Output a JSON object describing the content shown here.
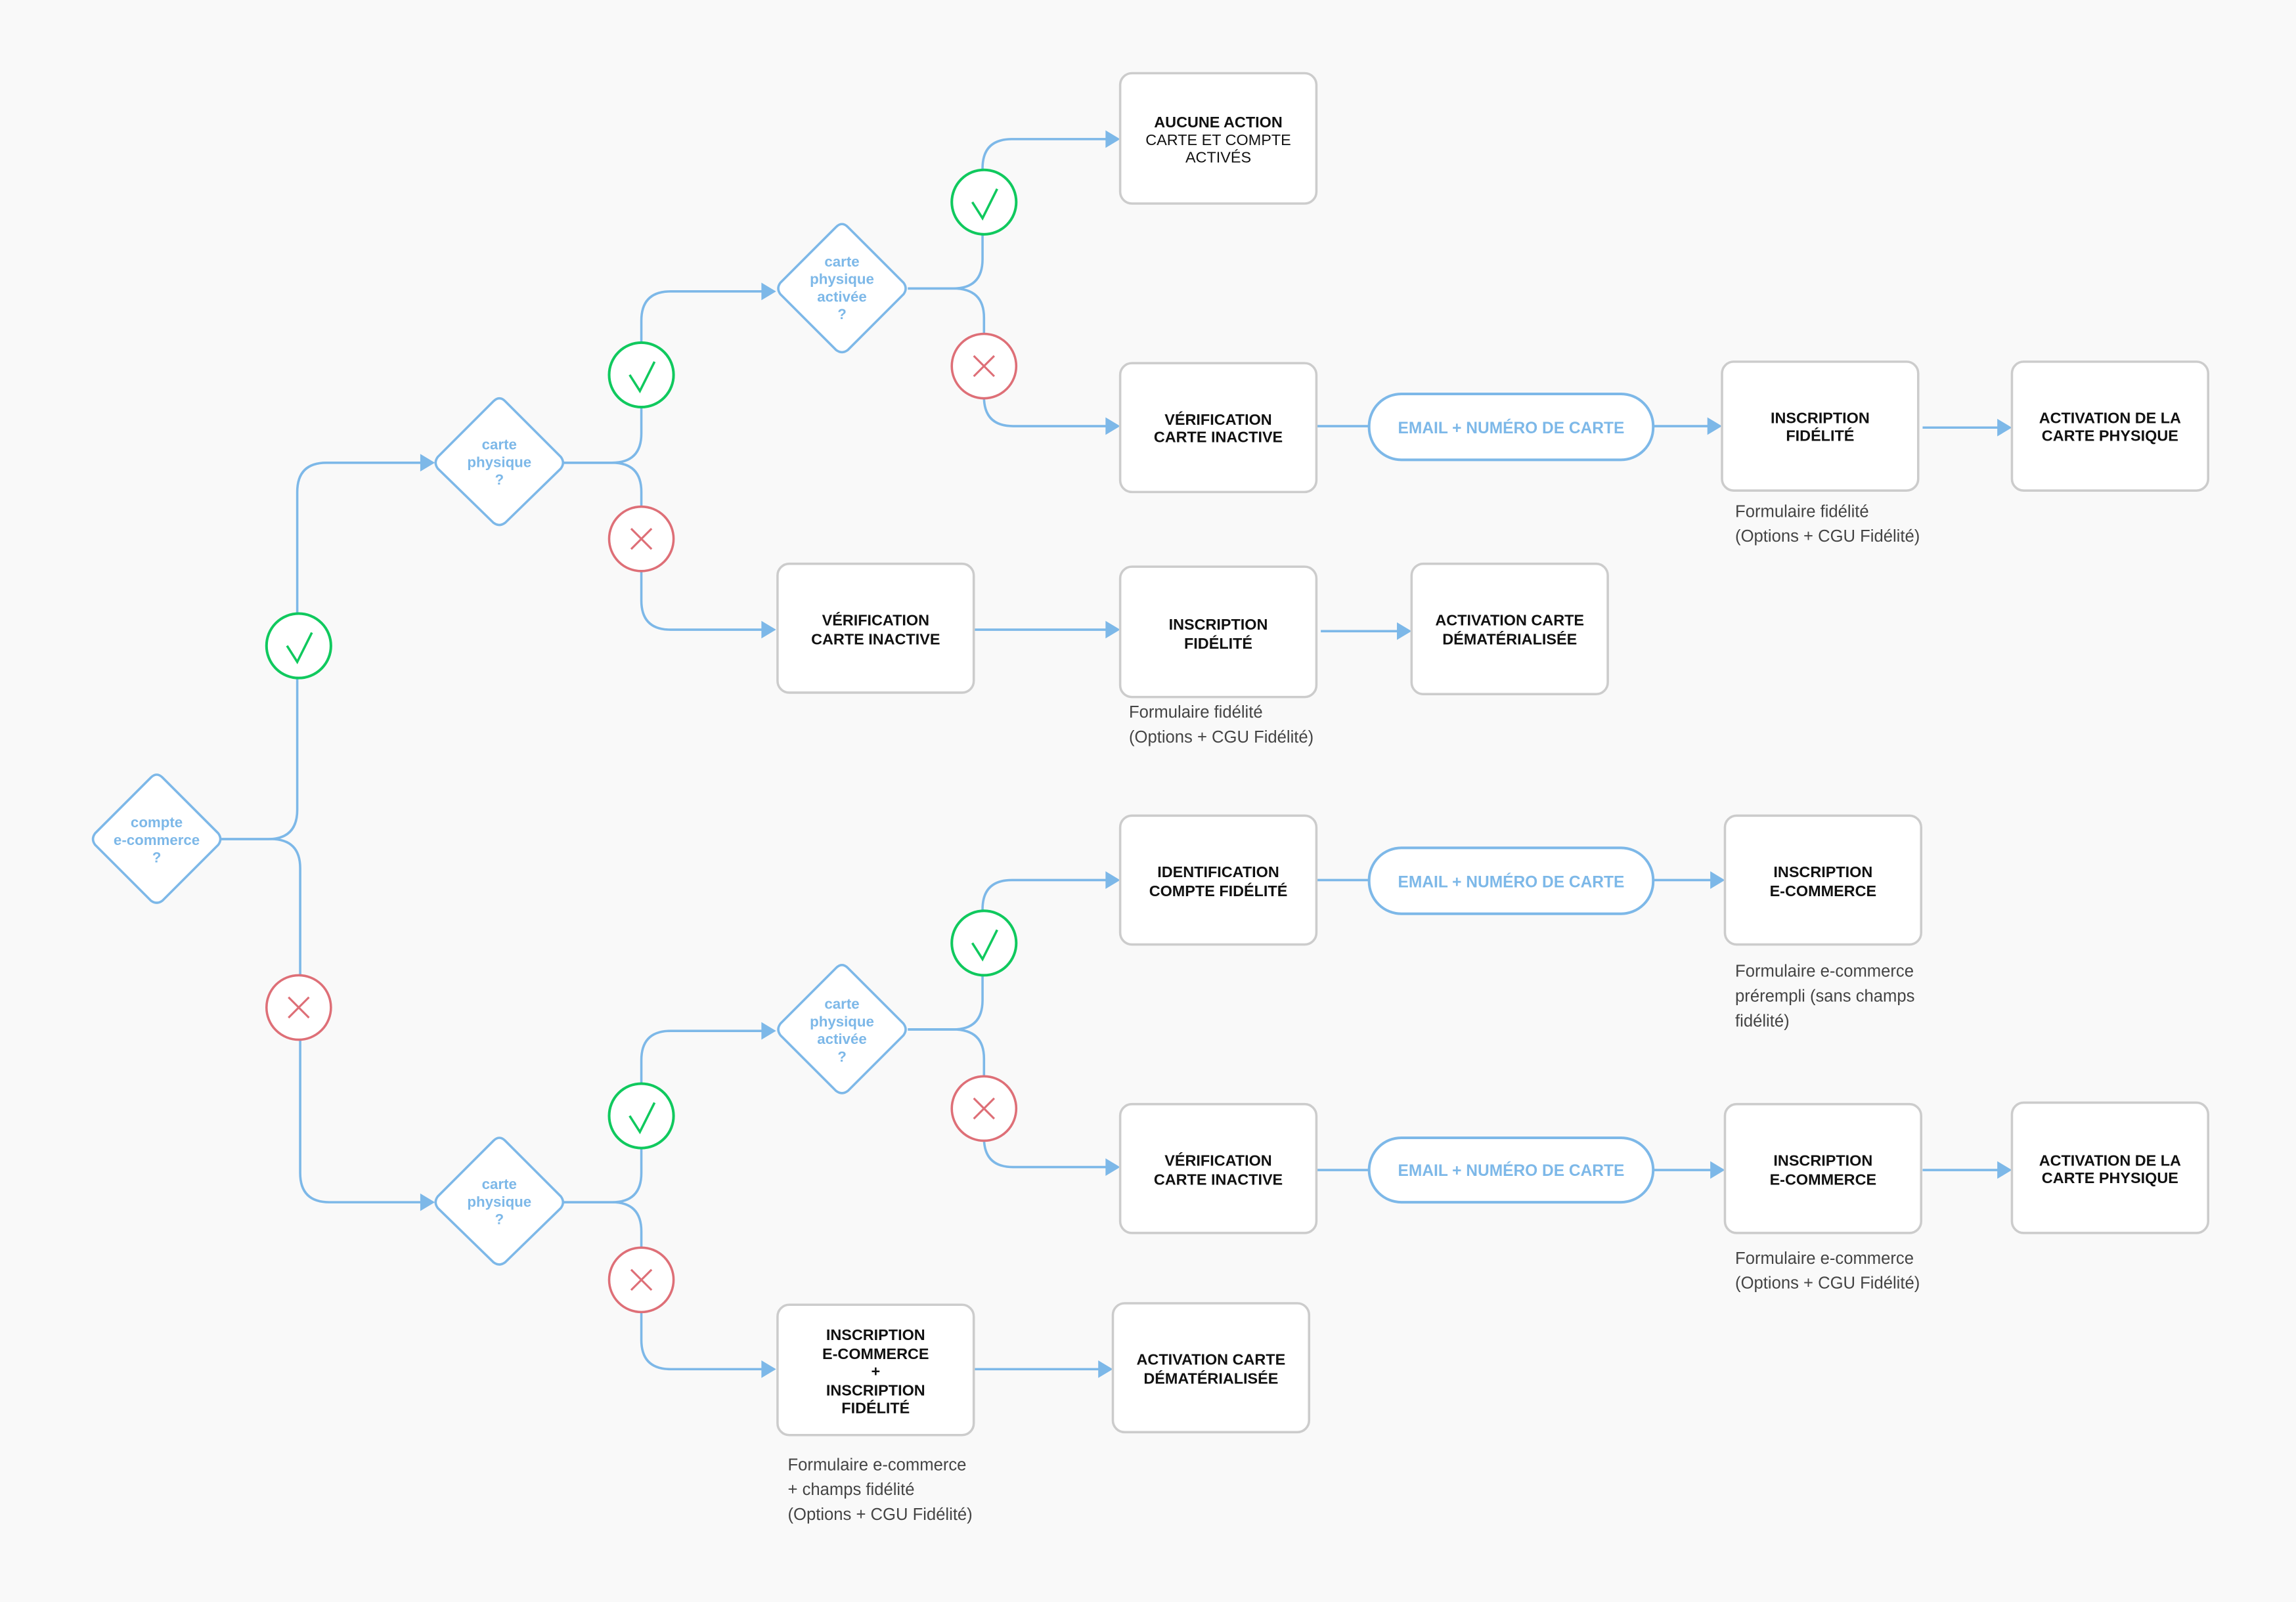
{
  "colors": {
    "background": "#f9f9f9",
    "connector": "#7db8e8",
    "decision_text": "#7db8e8",
    "box_border": "#cccccc",
    "yes": "#10c95e",
    "no": "#de6f77",
    "box_text": "#111111",
    "note_text": "#444444"
  },
  "decisions": {
    "compte_ecommerce": [
      "compte",
      "e-commerce",
      "?"
    ],
    "carte_physique_top": [
      "carte",
      "physique",
      "?"
    ],
    "carte_activee_top": [
      "carte",
      "physique",
      "activée",
      "?"
    ],
    "carte_physique_bottom": [
      "carte",
      "physique",
      "?"
    ],
    "carte_activee_bottom": [
      "carte",
      "physique",
      "activée",
      "?"
    ]
  },
  "outcomes": {
    "yes_icon": "check-icon",
    "no_icon": "cross-icon"
  },
  "boxes": {
    "aucune_action": {
      "title": "AUCUNE ACTION",
      "lines": [
        "CARTE ET COMPTE",
        "ACTIVÉS"
      ]
    },
    "verif_top_a": {
      "lines": [
        "VÉRIFICATION",
        "CARTE INACTIVE"
      ]
    },
    "inscription_fidelite_a": {
      "lines": [
        "INSCRIPTION",
        "FIDÉLITÉ"
      ],
      "note": [
        "Formulaire fidélité",
        "(Options + CGU Fidélité)"
      ]
    },
    "activation_physique_a": {
      "lines": [
        "ACTIVATION DE LA",
        "CARTE PHYSIQUE"
      ]
    },
    "verif_top_b": {
      "lines": [
        "VÉRIFICATION",
        "CARTE INACTIVE"
      ]
    },
    "inscription_fidelite_b": {
      "lines": [
        "INSCRIPTION",
        "FIDÉLITÉ"
      ],
      "note": [
        "Formulaire fidélité",
        "(Options + CGU Fidélité)"
      ]
    },
    "activation_demat_a": {
      "lines": [
        "ACTIVATION CARTE",
        "DÉMATÉRIALISÉE"
      ]
    },
    "identification": {
      "lines": [
        "IDENTIFICATION",
        "COMPTE FIDÉLITÉ"
      ]
    },
    "inscription_ecom_a": {
      "lines": [
        "INSCRIPTION",
        "E-COMMERCE"
      ],
      "note": [
        "Formulaire e-commerce",
        "prérempli (sans champs",
        "fidélité)"
      ]
    },
    "verif_bottom": {
      "lines": [
        "VÉRIFICATION",
        "CARTE INACTIVE"
      ]
    },
    "inscription_ecom_b": {
      "lines": [
        "INSCRIPTION",
        "E-COMMERCE"
      ],
      "note": [
        "Formulaire e-commerce",
        "(Options + CGU Fidélité)"
      ]
    },
    "activation_physique_b": {
      "lines": [
        "ACTIVATION DE LA",
        "CARTE PHYSIQUE"
      ]
    },
    "inscription_combo": {
      "lines": [
        "INSCRIPTION",
        "E-COMMERCE",
        "+",
        "INSCRIPTION",
        "FIDÉLITÉ"
      ],
      "note": [
        "Formulaire e-commerce",
        "+ champs fidélité",
        "(Options + CGU Fidélité)"
      ]
    },
    "activation_demat_b": {
      "lines": [
        "ACTIVATION CARTE",
        "DÉMATÉRIALISÉE"
      ]
    }
  },
  "inputs": {
    "email_card_label": "EMAIL + NUMÉRO DE CARTE"
  }
}
